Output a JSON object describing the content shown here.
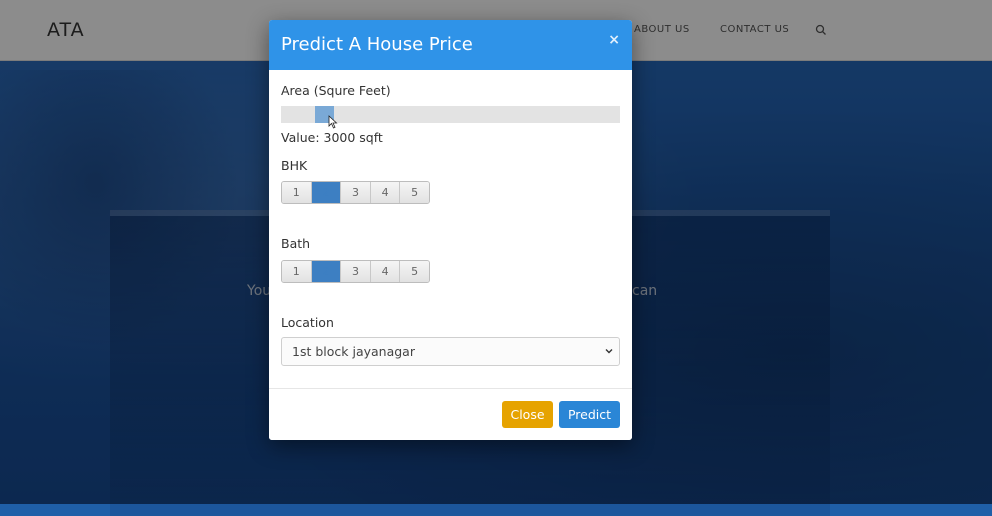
{
  "navbar": {
    "brand": "ATA",
    "links": [
      "ABOUT US",
      "CONTACT US"
    ]
  },
  "hero": {
    "text_left": "You",
    "text_right": "can"
  },
  "modal": {
    "title": "Predict A House Price",
    "close_x": "×",
    "area": {
      "label": "Area (Squre Feet)",
      "value_text": "Value: 3000 sqft",
      "slider_fraction": 0.1
    },
    "bhk": {
      "label": "BHK",
      "options": [
        "1",
        "2",
        "3",
        "4",
        "5"
      ],
      "selected": "2"
    },
    "bath": {
      "label": "Bath",
      "options": [
        "1",
        "2",
        "3",
        "4",
        "5"
      ],
      "selected": "2"
    },
    "location": {
      "label": "Location",
      "selected": "1st block jayanagar"
    },
    "buttons": {
      "close": "Close",
      "predict": "Predict"
    }
  },
  "colors": {
    "header": "#2f93e8",
    "close_button": "#e6a300",
    "predict_button": "#2a86d6",
    "selected_segment": "#3d7fc2"
  },
  "icons": [
    "search-icon",
    "close-icon",
    "chevron-down-icon",
    "mouse-cursor-icon"
  ]
}
